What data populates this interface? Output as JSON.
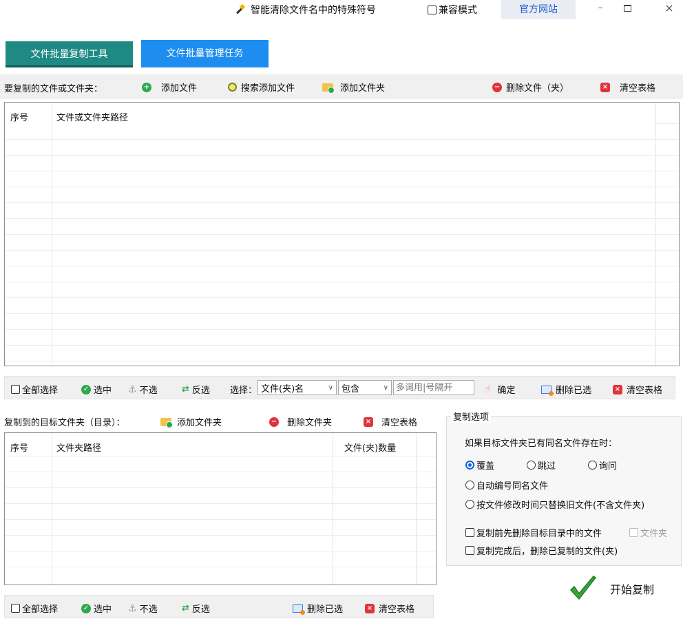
{
  "titlebar": {
    "title": "智能清除文件名中的特殊符号",
    "compat_label": "兼容模式",
    "official_site": "官方网站",
    "min": "–",
    "max": "□",
    "close": "×"
  },
  "tabs": [
    {
      "label": "文件批量复制工具"
    },
    {
      "label": "文件批量管理任务"
    }
  ],
  "top_toolbar": {
    "section_label": "要复制的文件或文件夹：",
    "add_file": "添加文件",
    "search_add_file": "搜索添加文件",
    "add_folder": "添加文件夹",
    "delete_file": "删除文件（夹）",
    "clear_table": "清空表格"
  },
  "source_table": {
    "col_index": "序号",
    "col_path": "文件或文件夹路径"
  },
  "select_bar": {
    "select_all": "全部选择",
    "select": "选中",
    "unselect": "不选",
    "invert": "反选",
    "choose_label": "选择：",
    "field_value": "文件(夹)名",
    "match_value": "包含",
    "keywords_placeholder": "多词用|号隔开",
    "confirm": "确定",
    "delete_selected": "删除已选",
    "clear_table": "清空表格"
  },
  "target_toolbar": {
    "section_label": "复制到的目标文件夹（目录）：",
    "add_folder": "添加文件夹",
    "delete_folder": "删除文件夹",
    "clear_table": "清空表格"
  },
  "target_table": {
    "col_index": "序号",
    "col_path": "文件夹路径",
    "col_count": "文件(夹)数量"
  },
  "bottom_bar": {
    "select_all": "全部选择",
    "select": "选中",
    "unselect": "不选",
    "invert": "反选",
    "delete_selected": "删除已选",
    "clear_table": "清空表格"
  },
  "options": {
    "group_title": "复制选项",
    "question": "如果目标文件夹已有同名文件存在时：",
    "overwrite": "覆盖",
    "skip": "跳过",
    "ask": "询问",
    "auto_number": "自动编号同名文件",
    "replace_by_time": "按文件修改时间只替换旧文件(不含文件夹)",
    "delete_target_first": "复制前先删除目标目录中的文件",
    "folder": "文件夹",
    "delete_after_copy": "复制完成后，删除已复制的文件(夹)"
  },
  "start_button": "开始复制",
  "colors": {
    "tab_active": "#1f8a84",
    "tab_secondary": "#1e8df0",
    "link": "#1a5fd0",
    "green_icon": "#2fa84f",
    "red_icon": "#e0343a"
  }
}
